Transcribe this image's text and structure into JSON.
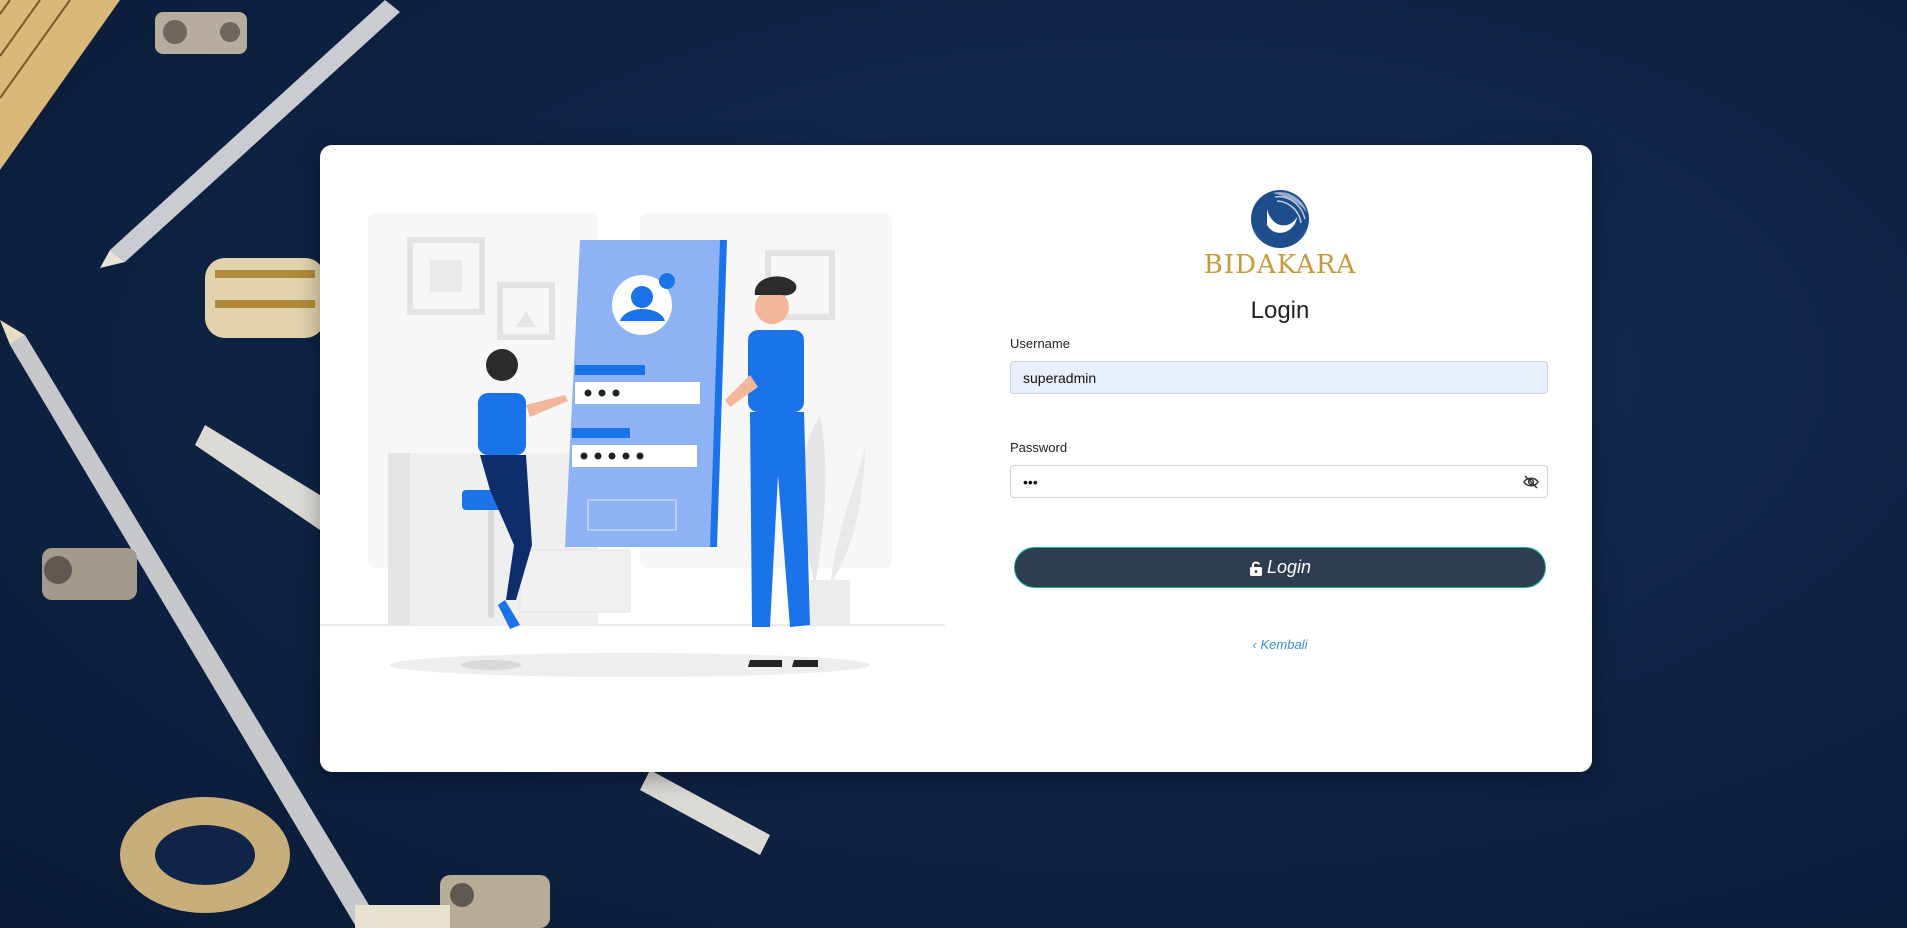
{
  "brand": {
    "logo_text": "BIDAKARA",
    "logo_color": "#c79a3b",
    "emblem_color": "#1e4d8c"
  },
  "login": {
    "title": "Login",
    "username_label": "Username",
    "username_value": "superadmin",
    "password_label": "Password",
    "password_value": "•••",
    "eye_icon": "eye-slash-icon",
    "submit_icon": "unlock-icon",
    "submit_label": "Login",
    "back_icon": "chevron-left-icon",
    "back_label": "Kembali"
  },
  "colors": {
    "background": "#0f2446",
    "button": "#2d3e50",
    "button_border": "#1ab394",
    "link": "#3a8fd8",
    "accent_blue": "#1a73e8"
  }
}
